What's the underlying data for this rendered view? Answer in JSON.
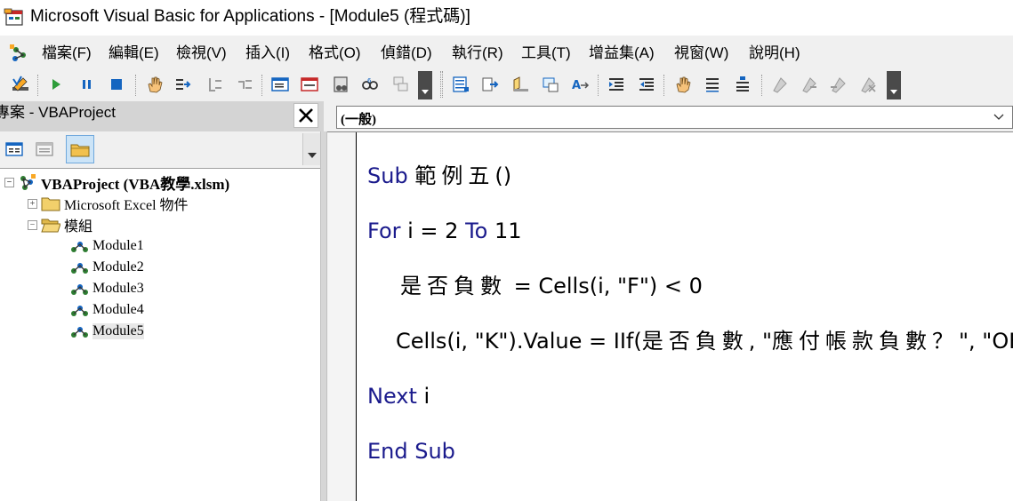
{
  "window": {
    "title": "Microsoft Visual Basic for Applications - [Module5 (程式碼)]"
  },
  "menu": [
    {
      "label": "檔案(F)"
    },
    {
      "label": "編輯(E)"
    },
    {
      "label": "檢視(V)"
    },
    {
      "label": "插入(I)"
    },
    {
      "label": "格式(O)"
    },
    {
      "label": "偵錯(D)"
    },
    {
      "label": "執行(R)"
    },
    {
      "label": "工具(T)"
    },
    {
      "label": "增益集(A)"
    },
    {
      "label": "視窗(W)"
    },
    {
      "label": "說明(H)"
    }
  ],
  "project_pane": {
    "title": "專案 - VBAProject",
    "close_glyph": "✕"
  },
  "tree": {
    "root": "VBAProject (VBA教學.xlsm)",
    "excel_objects": "Microsoft Excel 物件",
    "modules_folder": "模組",
    "expander_plus": "+",
    "expander_minus": "−",
    "modules": [
      {
        "label": "Module1"
      },
      {
        "label": "Module2"
      },
      {
        "label": "Module3"
      },
      {
        "label": "Module4"
      },
      {
        "label": "Module5",
        "selected": true
      }
    ]
  },
  "code_window": {
    "object_combo": "(一般)",
    "lines": [
      {
        "kw": "Sub",
        "rest_cjk": "範例五",
        "rest": "()"
      },
      {
        "kw": "For",
        "rest": " i = 2 ",
        "kw2": "To",
        "rest2": " 11"
      },
      {
        "cjk": "是否負數",
        "rest": " = Cells(i, \"F\") < 0"
      },
      {
        "a": "Cells(i, \"K\").Value = IIf(",
        "cjk": "是否負數",
        "b": ", \"",
        "cjk2": "應付帳款負數？",
        "c": "\", \"OK\")"
      },
      {
        "kw": "Next",
        "rest": " i"
      },
      {
        "kw": "End Sub"
      }
    ]
  },
  "colors": {
    "keyword": "#1a1a8c",
    "code_text": "#000000",
    "pane_header": "#d4d4d4"
  }
}
